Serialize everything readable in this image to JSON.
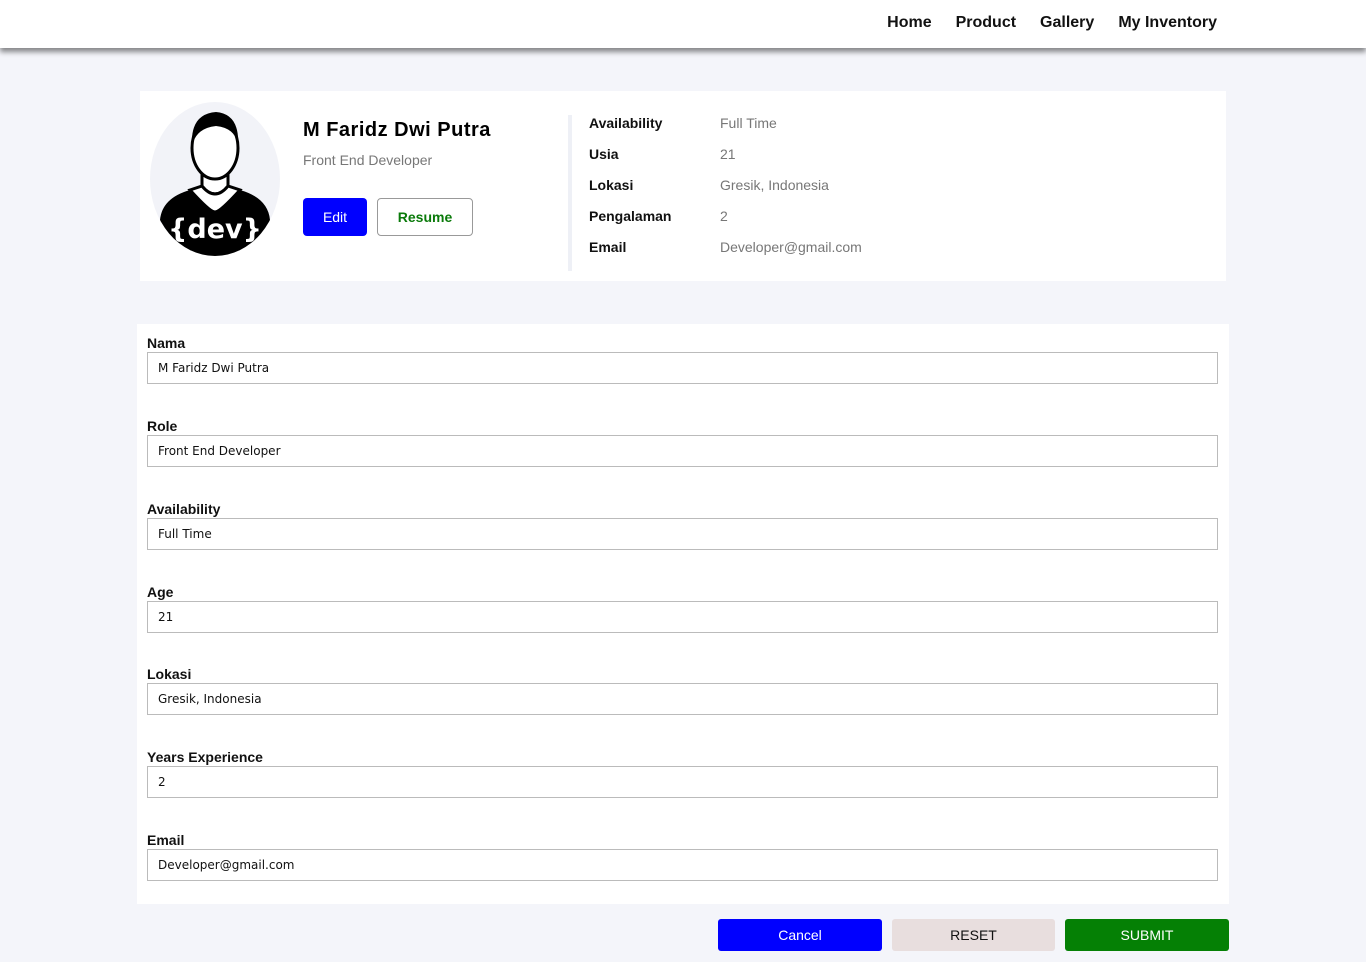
{
  "nav": {
    "links": [
      {
        "label": "Home"
      },
      {
        "label": "Product"
      },
      {
        "label": "Gallery"
      },
      {
        "label": "My Inventory"
      }
    ]
  },
  "profile": {
    "avatar_icon": "developer-avatar-icon",
    "avatar_text": "{dev}",
    "name": "M Faridz Dwi Putra",
    "role": "Front End Developer",
    "edit_label": "Edit",
    "resume_label": "Resume",
    "details": [
      {
        "label": "Availability",
        "value": "Full Time"
      },
      {
        "label": "Usia",
        "value": "21"
      },
      {
        "label": "Lokasi",
        "value": "Gresik, Indonesia"
      },
      {
        "label": "Pengalaman",
        "value": "2"
      },
      {
        "label": "Email",
        "value": "Developer@gmail.com"
      }
    ]
  },
  "form": {
    "fields": [
      {
        "label": "Nama",
        "value": "M Faridz Dwi Putra"
      },
      {
        "label": "Role",
        "value": "Front End Developer"
      },
      {
        "label": "Availability",
        "value": "Full Time"
      },
      {
        "label": "Age",
        "value": "21"
      },
      {
        "label": "Lokasi",
        "value": "Gresik, Indonesia"
      },
      {
        "label": "Years Experience",
        "value": "2"
      },
      {
        "label": "Email",
        "value": "Developer@gmail.com"
      }
    ]
  },
  "actions": {
    "cancel_label": "Cancel",
    "reset_label": "RESET",
    "submit_label": "SUBMIT"
  },
  "colors": {
    "primary_blue": "#0000ff",
    "submit_green": "#058005",
    "reset_bg": "#e8dede",
    "page_bg": "#f4f5fa"
  }
}
